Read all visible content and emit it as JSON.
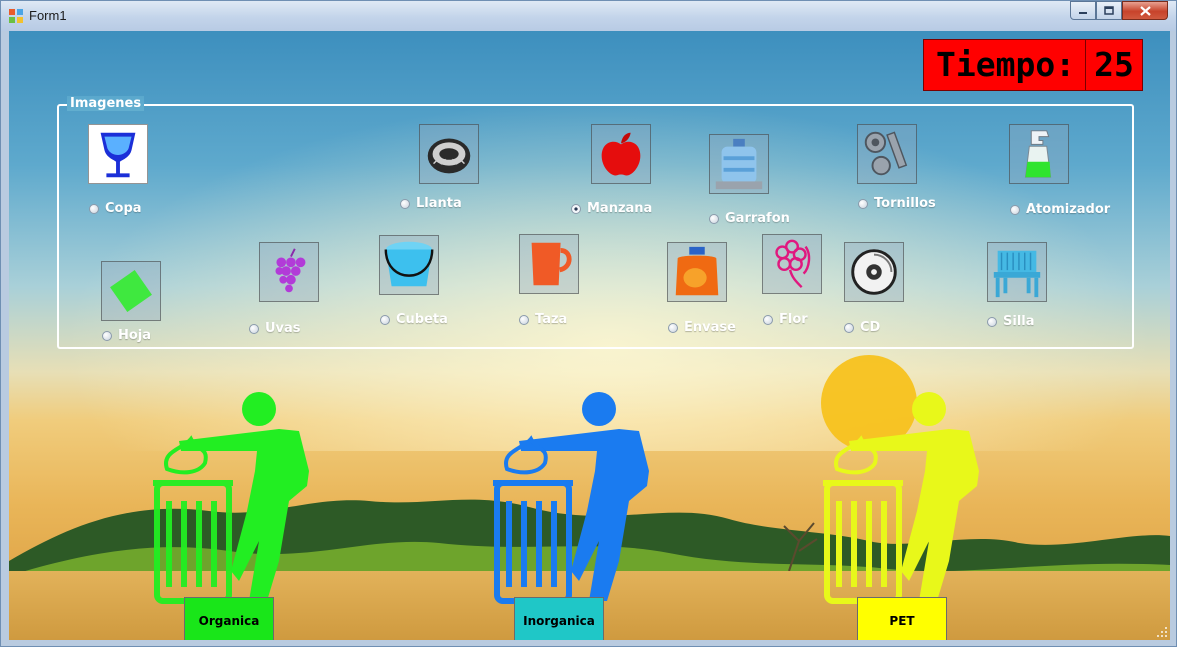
{
  "window": {
    "title": "Form1"
  },
  "timer": {
    "label": "Tiempo:",
    "value": "25"
  },
  "group": {
    "title": "Imagenes"
  },
  "items": [
    {
      "label": "Copa",
      "icon": "wine-glass-icon",
      "checked": false
    },
    {
      "label": "Llanta",
      "icon": "tire-icon",
      "checked": false
    },
    {
      "label": "Manzana",
      "icon": "apple-icon",
      "checked": true
    },
    {
      "label": "Garrafon",
      "icon": "water-jug-icon",
      "checked": false
    },
    {
      "label": "Tornillos",
      "icon": "screws-icon",
      "checked": false
    },
    {
      "label": "Atomizador",
      "icon": "spray-bottle-icon",
      "checked": false
    },
    {
      "label": "Hoja",
      "icon": "leaf-icon",
      "checked": false
    },
    {
      "label": "Uvas",
      "icon": "grapes-icon",
      "checked": false
    },
    {
      "label": "Cubeta",
      "icon": "bucket-icon",
      "checked": false
    },
    {
      "label": "Taza",
      "icon": "mug-icon",
      "checked": false
    },
    {
      "label": "Envase",
      "icon": "detergent-bottle-icon",
      "checked": false
    },
    {
      "label": "Flor",
      "icon": "flower-icon",
      "checked": false
    },
    {
      "label": "CD",
      "icon": "cd-icon",
      "checked": false
    },
    {
      "label": "Silla",
      "icon": "chair-icon",
      "checked": false
    }
  ],
  "bins": [
    {
      "label": "Organica",
      "color": "#19e619"
    },
    {
      "label": "Inorganica",
      "color": "#1fc7c7"
    },
    {
      "label": "PET",
      "color": "#ffff00"
    }
  ],
  "colors": {
    "organic": "#22ee22",
    "inorganic": "#1a7bf0",
    "pet": "#e8f81a",
    "timer_bg": "#ff0000"
  }
}
